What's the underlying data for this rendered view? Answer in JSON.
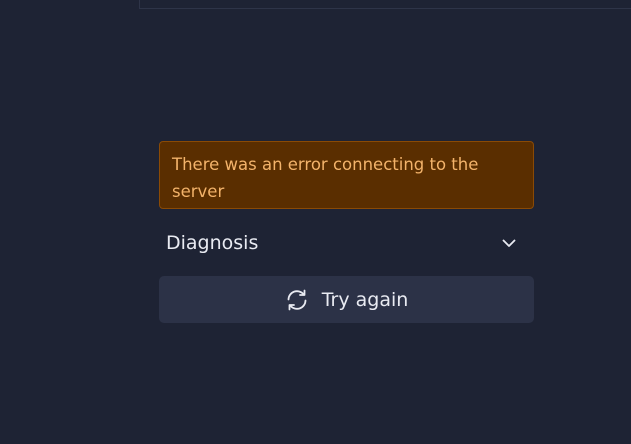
{
  "error": {
    "message": "There was an error connecting to the server"
  },
  "diagnosis": {
    "label": "Diagnosis",
    "icon": "chevron-down-icon"
  },
  "retry": {
    "label": "Try again",
    "icon": "refresh-icon"
  },
  "colors": {
    "background": "#1e2334",
    "error_background": "#5a2e00",
    "error_border": "#8a4a05",
    "error_text": "#f3b36a",
    "button_background": "#2c3247",
    "text": "#e9ebf2"
  }
}
